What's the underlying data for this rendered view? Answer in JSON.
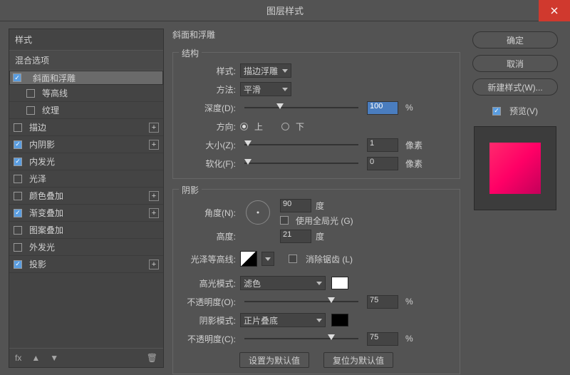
{
  "title": "图层样式",
  "left": {
    "styles_hdr": "样式",
    "blend_hdr": "混合选项",
    "items": [
      {
        "label": "斜面和浮雕",
        "checked": true,
        "sel": true,
        "plus": false,
        "indent": 0
      },
      {
        "label": "等高线",
        "checked": false,
        "sel": false,
        "plus": false,
        "indent": 1
      },
      {
        "label": "纹理",
        "checked": false,
        "sel": false,
        "plus": false,
        "indent": 1
      },
      {
        "label": "描边",
        "checked": false,
        "sel": false,
        "plus": true,
        "indent": 0
      },
      {
        "label": "内阴影",
        "checked": true,
        "sel": false,
        "plus": true,
        "indent": 0
      },
      {
        "label": "内发光",
        "checked": true,
        "sel": false,
        "plus": false,
        "indent": 0
      },
      {
        "label": "光泽",
        "checked": false,
        "sel": false,
        "plus": false,
        "indent": 0
      },
      {
        "label": "颜色叠加",
        "checked": false,
        "sel": false,
        "plus": true,
        "indent": 0
      },
      {
        "label": "渐变叠加",
        "checked": true,
        "sel": false,
        "plus": true,
        "indent": 0
      },
      {
        "label": "图案叠加",
        "checked": false,
        "sel": false,
        "plus": false,
        "indent": 0
      },
      {
        "label": "外发光",
        "checked": false,
        "sel": false,
        "plus": false,
        "indent": 0
      },
      {
        "label": "投影",
        "checked": true,
        "sel": false,
        "plus": true,
        "indent": 0
      }
    ],
    "fx": "fx"
  },
  "mid": {
    "sect_title": "斜面和浮雕",
    "struct": {
      "legend": "结构",
      "style_lab": "样式:",
      "style_val": "描边浮雕",
      "tech_lab": "方法:",
      "tech_val": "平滑",
      "depth_lab": "深度(D):",
      "depth_val": "100",
      "depth_unit": "%",
      "dir_lab": "方向:",
      "dir_up": "上",
      "dir_dn": "下",
      "size_lab": "大小(Z):",
      "size_val": "1",
      "size_unit": "像素",
      "soft_lab": "软化(F):",
      "soft_val": "0",
      "soft_unit": "像素"
    },
    "shade": {
      "legend": "阴影",
      "ang_lab": "角度(N):",
      "ang_val": "90",
      "ang_unit": "度",
      "glob": "使用全局光 (G)",
      "alt_lab": "高度:",
      "alt_val": "21",
      "alt_unit": "度",
      "cont_lab": "光泽等高线:",
      "aa": "消除锯齿 (L)",
      "hi_lab": "高光模式:",
      "hi_val": "滤色",
      "hi_op_lab": "不透明度(O):",
      "hi_op_val": "75",
      "hi_op_unit": "%",
      "sh_lab": "阴影模式:",
      "sh_val": "正片叠底",
      "sh_op_lab": "不透明度(C):",
      "sh_op_val": "75",
      "sh_op_unit": "%"
    },
    "btns": {
      "def": "设置为默认值",
      "reset": "复位为默认值"
    }
  },
  "right": {
    "ok": "确定",
    "cancel": "取消",
    "newstyle": "新建样式(W)...",
    "preview": "预览(V)"
  }
}
